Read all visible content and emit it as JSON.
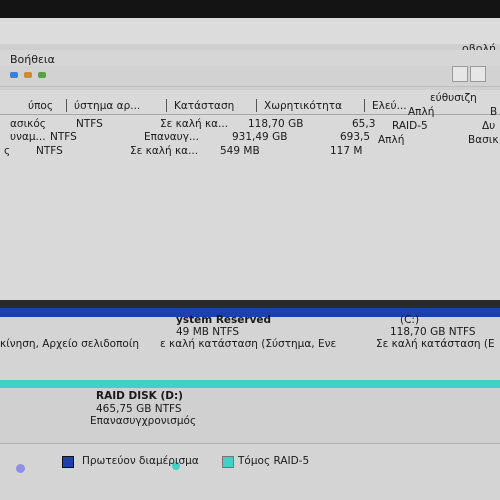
{
  "window": {
    "title_fragment": "οβολή"
  },
  "menu": {
    "help": "Βοήθεια"
  },
  "table": {
    "headers": {
      "type": "ύπος",
      "filesystem": "ύστημα αρ...",
      "status": "Κατάσταση",
      "capacity": "Χωρητικότητα",
      "free": "Ελεύ...",
      "fault": "εύθυσιζη"
    },
    "rows": [
      {
        "type": "ασικός",
        "fs": "NTFS",
        "status": "Σε καλή κα...",
        "capacity": "118,70 GB",
        "free": "65,3",
        "layout": "Απλή",
        "disk": "Β"
      },
      {
        "type": "υναμ...",
        "fs": "NTFS",
        "status": "Επαναυγ...",
        "capacity": "931,49 GB",
        "free": "693,5",
        "layout": "RAID-5",
        "disk": "Δυ"
      },
      {
        "type": "ς",
        "fs": "NTFS",
        "status": "Σε καλή κα...",
        "capacity": "549 MB",
        "free": "117 M",
        "layout": "Απλή",
        "disk": "Βασικ"
      }
    ]
  },
  "graph": {
    "system_reserved": {
      "name": "ystem Reserved",
      "size": "49 MB NTFS",
      "status": "ε καλή κατάσταση (Σύστημα, Ενε"
    },
    "left_fragment": {
      "status": "κίνηση, Αρχείο σελιδοποίη"
    },
    "c_drive": {
      "name": "(C:)",
      "size": "118,70 GB NTFS",
      "status": "Σε καλή κατάσταση (Ε"
    },
    "raid_volume": {
      "name": "RAID DISK  (D:)",
      "size": "465,75 GB NTFS",
      "status": "Επανασυγχρονισμός"
    }
  },
  "legend": {
    "primary": "Πρωτεύον διαμέρισμα",
    "raid5": "Τόμος RAID-5"
  },
  "colors": {
    "primary_partition": "#1f3fb0",
    "raid5_volume": "#3fd1c6"
  }
}
